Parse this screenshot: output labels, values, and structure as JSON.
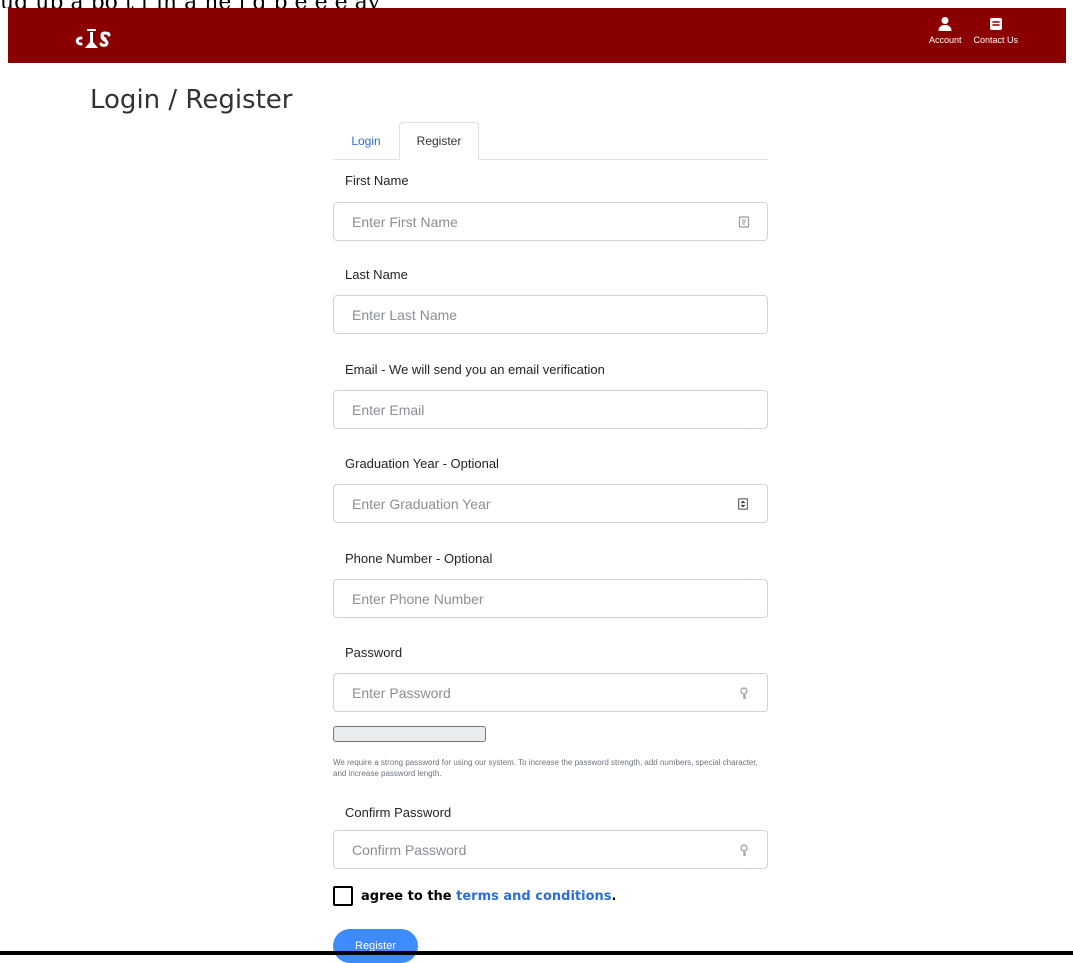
{
  "overlay": {
    "text": "ud up a po t f in a ne i g p e e e ay"
  },
  "header": {
    "brand_text": "CAS",
    "account_label": "Account",
    "contact_label": "Contact Us"
  },
  "page": {
    "title": "Login / Register"
  },
  "tabs": {
    "login": "Login",
    "register": "Register"
  },
  "form": {
    "first_name": {
      "label": "First Name",
      "placeholder": "Enter First Name"
    },
    "last_name": {
      "label": "Last Name",
      "placeholder": "Enter Last Name"
    },
    "email": {
      "label": "Email - We will send you an email verification",
      "placeholder": "Enter Email"
    },
    "graduation_year": {
      "label": "Graduation Year - Optional",
      "placeholder": "Enter Graduation Year"
    },
    "phone": {
      "label": "Phone Number - Optional",
      "placeholder": "Enter Phone Number"
    },
    "password": {
      "label": "Password",
      "placeholder": "Enter Password",
      "strength_percent": 0,
      "help": "We require a strong password for using our system. To increase the password strength, add numbers, special character, and increase password length."
    },
    "confirm_password": {
      "label": "Confirm Password",
      "placeholder": "Confirm Password"
    },
    "agree": {
      "prefix": "agree to the",
      "link": "terms and conditions",
      "suffix": "."
    },
    "submit_label": "Register"
  },
  "colors": {
    "header_bg": "#8a0000",
    "link": "#2b6fd6",
    "button": "#3d8bfd"
  }
}
